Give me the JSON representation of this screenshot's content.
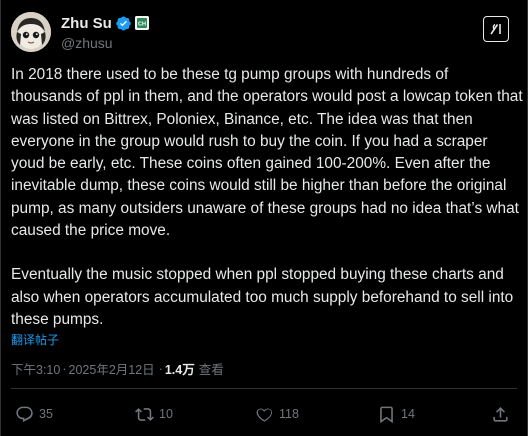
{
  "author": {
    "display_name": "Zhu Su",
    "handle": "@zhusu",
    "verified_badge_color": "#1d9bf0",
    "affiliate_badge_text": "CH"
  },
  "post": {
    "paragraph_1": "In 2018 there used to be these tg pump groups with hundreds of thousands of ppl in them, and the operators would post a lowcap token that was listed on Bittrex, Poloniex, Binance, etc. The idea was that then everyone in the group would rush to buy the coin. If you had a scraper youd be early, etc. These coins often gained 100-200%. Even after the inevitable dump, these coins would still be higher than before the original pump, as many outsiders unaware of these groups had no idea that’s what caused the price move.",
    "paragraph_2": "Eventually the music stopped when ppl stopped buying these charts and also when operators accumulated too much supply beforehand to sell into these pumps.",
    "translate_label": "翻译帖子"
  },
  "meta": {
    "time": "下午3:10",
    "separator": "·",
    "date": "2025年2月12日",
    "views_count": "1.4万",
    "views_label": "查看"
  },
  "actions": {
    "replies": "35",
    "reposts": "10",
    "likes": "118",
    "bookmarks": "14"
  },
  "icons": {
    "grok": "grok-icon",
    "reply": "reply-icon",
    "repost": "repost-icon",
    "like": "heart-icon",
    "bookmark": "bookmark-icon",
    "share": "share-icon"
  },
  "colors": {
    "background": "#000000",
    "text": "#e7e9ea",
    "secondary": "#71767b",
    "link": "#1d9bf0"
  }
}
